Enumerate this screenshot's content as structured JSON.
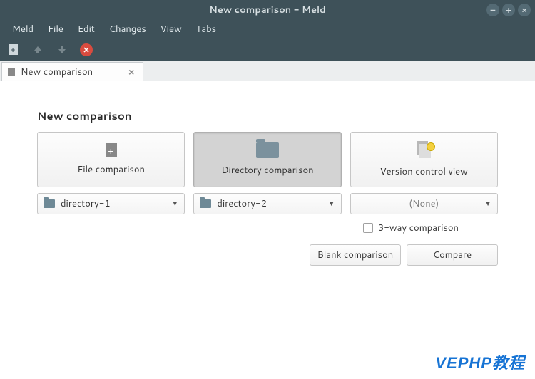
{
  "window": {
    "title": "New comparison - Meld"
  },
  "menubar": [
    "Meld",
    "File",
    "Edit",
    "Changes",
    "View",
    "Tabs"
  ],
  "tab": {
    "label": "New comparison"
  },
  "heading": "New comparison",
  "modes": {
    "file": {
      "label": "File comparison"
    },
    "dir": {
      "label": "Directory comparison"
    },
    "vc": {
      "label": "Version control view"
    }
  },
  "pickers": {
    "left": "directory-1",
    "middle": "directory-2",
    "right": "(None)"
  },
  "threeway_label": "3-way comparison",
  "actions": {
    "blank": "Blank comparison",
    "compare": "Compare"
  },
  "watermark": "VEPHP教程"
}
